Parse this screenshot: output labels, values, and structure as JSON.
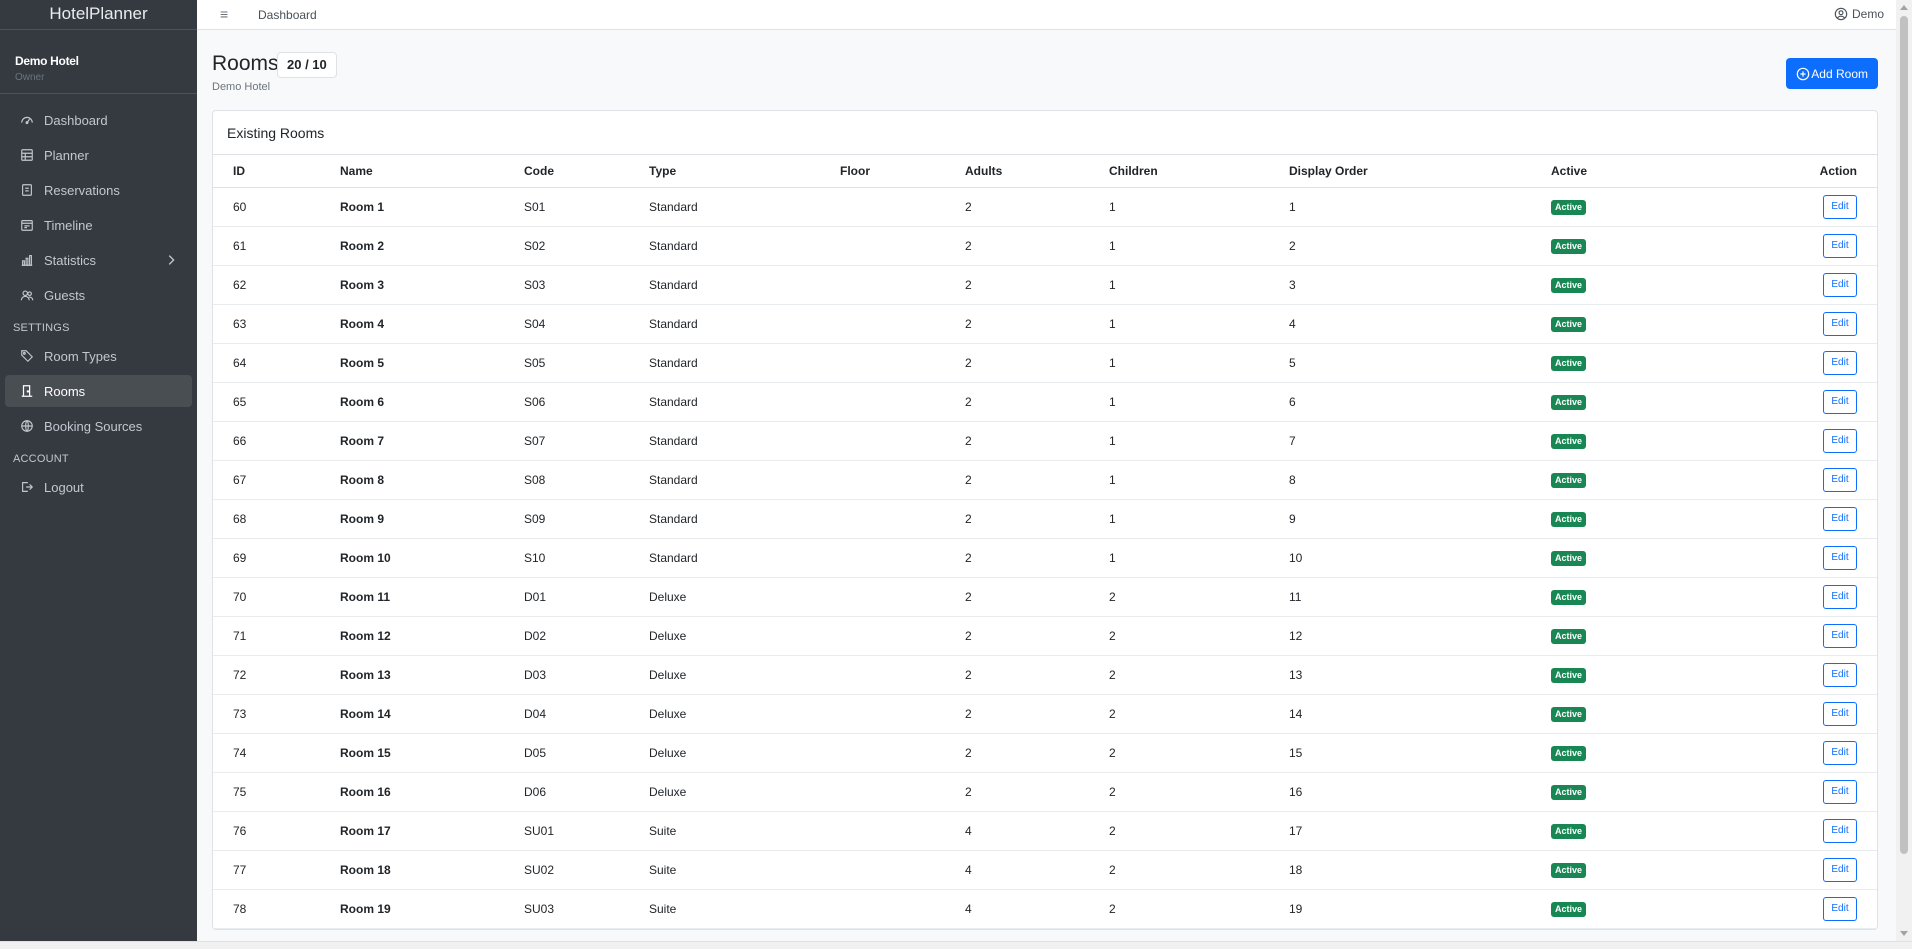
{
  "app": {
    "brand": "HotelPlanner"
  },
  "user_block": {
    "hotel": "Demo Hotel",
    "role": "Owner"
  },
  "nav": {
    "dashboard": "Dashboard",
    "planner": "Planner",
    "reservations": "Reservations",
    "timeline": "Timeline",
    "statistics": "Statistics",
    "guests": "Guests",
    "settings_header": "SETTINGS",
    "room_types": "Room Types",
    "rooms": "Rooms",
    "booking_sources": "Booking Sources",
    "account_header": "ACCOUNT",
    "logout": "Logout"
  },
  "topbar": {
    "breadcrumb": "Dashboard",
    "user": "Demo"
  },
  "page": {
    "title": "Rooms",
    "count": "20 / 10",
    "subtitle": "Demo Hotel",
    "add_button": "Add Room"
  },
  "card": {
    "title": "Existing Rooms"
  },
  "table": {
    "columns": [
      "ID",
      "Name",
      "Code",
      "Type",
      "Floor",
      "Adults",
      "Children",
      "Display Order",
      "Active",
      "Action"
    ],
    "rows": [
      {
        "id": "60",
        "name": "Room 1",
        "code": "S01",
        "type": "Standard",
        "floor": "",
        "adults": "2",
        "children": "1",
        "order": "1",
        "active": "Active",
        "action": "Edit"
      },
      {
        "id": "61",
        "name": "Room 2",
        "code": "S02",
        "type": "Standard",
        "floor": "",
        "adults": "2",
        "children": "1",
        "order": "2",
        "active": "Active",
        "action": "Edit"
      },
      {
        "id": "62",
        "name": "Room 3",
        "code": "S03",
        "type": "Standard",
        "floor": "",
        "adults": "2",
        "children": "1",
        "order": "3",
        "active": "Active",
        "action": "Edit"
      },
      {
        "id": "63",
        "name": "Room 4",
        "code": "S04",
        "type": "Standard",
        "floor": "",
        "adults": "2",
        "children": "1",
        "order": "4",
        "active": "Active",
        "action": "Edit"
      },
      {
        "id": "64",
        "name": "Room 5",
        "code": "S05",
        "type": "Standard",
        "floor": "",
        "adults": "2",
        "children": "1",
        "order": "5",
        "active": "Active",
        "action": "Edit"
      },
      {
        "id": "65",
        "name": "Room 6",
        "code": "S06",
        "type": "Standard",
        "floor": "",
        "adults": "2",
        "children": "1",
        "order": "6",
        "active": "Active",
        "action": "Edit"
      },
      {
        "id": "66",
        "name": "Room 7",
        "code": "S07",
        "type": "Standard",
        "floor": "",
        "adults": "2",
        "children": "1",
        "order": "7",
        "active": "Active",
        "action": "Edit"
      },
      {
        "id": "67",
        "name": "Room 8",
        "code": "S08",
        "type": "Standard",
        "floor": "",
        "adults": "2",
        "children": "1",
        "order": "8",
        "active": "Active",
        "action": "Edit"
      },
      {
        "id": "68",
        "name": "Room 9",
        "code": "S09",
        "type": "Standard",
        "floor": "",
        "adults": "2",
        "children": "1",
        "order": "9",
        "active": "Active",
        "action": "Edit"
      },
      {
        "id": "69",
        "name": "Room 10",
        "code": "S10",
        "type": "Standard",
        "floor": "",
        "adults": "2",
        "children": "1",
        "order": "10",
        "active": "Active",
        "action": "Edit"
      },
      {
        "id": "70",
        "name": "Room 11",
        "code": "D01",
        "type": "Deluxe",
        "floor": "",
        "adults": "2",
        "children": "2",
        "order": "11",
        "active": "Active",
        "action": "Edit"
      },
      {
        "id": "71",
        "name": "Room 12",
        "code": "D02",
        "type": "Deluxe",
        "floor": "",
        "adults": "2",
        "children": "2",
        "order": "12",
        "active": "Active",
        "action": "Edit"
      },
      {
        "id": "72",
        "name": "Room 13",
        "code": "D03",
        "type": "Deluxe",
        "floor": "",
        "adults": "2",
        "children": "2",
        "order": "13",
        "active": "Active",
        "action": "Edit"
      },
      {
        "id": "73",
        "name": "Room 14",
        "code": "D04",
        "type": "Deluxe",
        "floor": "",
        "adults": "2",
        "children": "2",
        "order": "14",
        "active": "Active",
        "action": "Edit"
      },
      {
        "id": "74",
        "name": "Room 15",
        "code": "D05",
        "type": "Deluxe",
        "floor": "",
        "adults": "2",
        "children": "2",
        "order": "15",
        "active": "Active",
        "action": "Edit"
      },
      {
        "id": "75",
        "name": "Room 16",
        "code": "D06",
        "type": "Deluxe",
        "floor": "",
        "adults": "2",
        "children": "2",
        "order": "16",
        "active": "Active",
        "action": "Edit"
      },
      {
        "id": "76",
        "name": "Room 17",
        "code": "SU01",
        "type": "Suite",
        "floor": "",
        "adults": "4",
        "children": "2",
        "order": "17",
        "active": "Active",
        "action": "Edit"
      },
      {
        "id": "77",
        "name": "Room 18",
        "code": "SU02",
        "type": "Suite",
        "floor": "",
        "adults": "4",
        "children": "2",
        "order": "18",
        "active": "Active",
        "action": "Edit"
      },
      {
        "id": "78",
        "name": "Room 19",
        "code": "SU03",
        "type": "Suite",
        "floor": "",
        "adults": "4",
        "children": "2",
        "order": "19",
        "active": "Active",
        "action": "Edit"
      }
    ]
  },
  "colors": {
    "sidebar": "#343a40",
    "primary": "#0d6efd",
    "success": "#198754"
  }
}
